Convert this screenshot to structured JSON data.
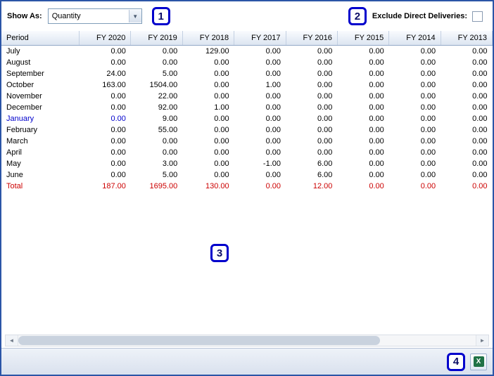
{
  "colors": {
    "window_border": "#2b55a7",
    "callout_border": "#0000cc",
    "current_row": "#0000cc",
    "total_row": "#cc0000",
    "excel_green": "#1f7246"
  },
  "toolbar": {
    "show_as_label": "Show As:",
    "show_as_value": "Quantity",
    "exclude_label": "Exclude Direct Deliveries:"
  },
  "callouts": [
    "1",
    "2",
    "3",
    "4"
  ],
  "icons": {
    "dropdown_arrow": "▼",
    "scroll_left": "◄",
    "scroll_right": "►",
    "excel": "X"
  },
  "table": {
    "columns": [
      "Period",
      "FY 2020",
      "FY 2019",
      "FY 2018",
      "FY 2017",
      "FY 2016",
      "FY 2015",
      "FY 2014",
      "FY 2013"
    ],
    "rows": [
      {
        "period": "July",
        "type": "normal",
        "values": [
          "0.00",
          "0.00",
          "129.00",
          "0.00",
          "0.00",
          "0.00",
          "0.00",
          "0.00"
        ]
      },
      {
        "period": "August",
        "type": "normal",
        "values": [
          "0.00",
          "0.00",
          "0.00",
          "0.00",
          "0.00",
          "0.00",
          "0.00",
          "0.00"
        ]
      },
      {
        "period": "September",
        "type": "normal",
        "values": [
          "24.00",
          "5.00",
          "0.00",
          "0.00",
          "0.00",
          "0.00",
          "0.00",
          "0.00"
        ]
      },
      {
        "period": "October",
        "type": "normal",
        "values": [
          "163.00",
          "1504.00",
          "0.00",
          "1.00",
          "0.00",
          "0.00",
          "0.00",
          "0.00"
        ]
      },
      {
        "period": "November",
        "type": "normal",
        "values": [
          "0.00",
          "22.00",
          "0.00",
          "0.00",
          "0.00",
          "0.00",
          "0.00",
          "0.00"
        ]
      },
      {
        "period": "December",
        "type": "normal",
        "values": [
          "0.00",
          "92.00",
          "1.00",
          "0.00",
          "0.00",
          "0.00",
          "0.00",
          "0.00"
        ]
      },
      {
        "period": "January",
        "type": "current",
        "values": [
          "0.00",
          "9.00",
          "0.00",
          "0.00",
          "0.00",
          "0.00",
          "0.00",
          "0.00"
        ]
      },
      {
        "period": "February",
        "type": "normal",
        "values": [
          "0.00",
          "55.00",
          "0.00",
          "0.00",
          "0.00",
          "0.00",
          "0.00",
          "0.00"
        ]
      },
      {
        "period": "March",
        "type": "normal",
        "values": [
          "0.00",
          "0.00",
          "0.00",
          "0.00",
          "0.00",
          "0.00",
          "0.00",
          "0.00"
        ]
      },
      {
        "period": "April",
        "type": "normal",
        "values": [
          "0.00",
          "0.00",
          "0.00",
          "0.00",
          "0.00",
          "0.00",
          "0.00",
          "0.00"
        ]
      },
      {
        "period": "May",
        "type": "normal",
        "values": [
          "0.00",
          "3.00",
          "0.00",
          "-1.00",
          "6.00",
          "0.00",
          "0.00",
          "0.00"
        ]
      },
      {
        "period": "June",
        "type": "normal",
        "values": [
          "0.00",
          "5.00",
          "0.00",
          "0.00",
          "6.00",
          "0.00",
          "0.00",
          "0.00"
        ]
      },
      {
        "period": "Total",
        "type": "total",
        "values": [
          "187.00",
          "1695.00",
          "130.00",
          "0.00",
          "12.00",
          "0.00",
          "0.00",
          "0.00"
        ]
      }
    ]
  }
}
